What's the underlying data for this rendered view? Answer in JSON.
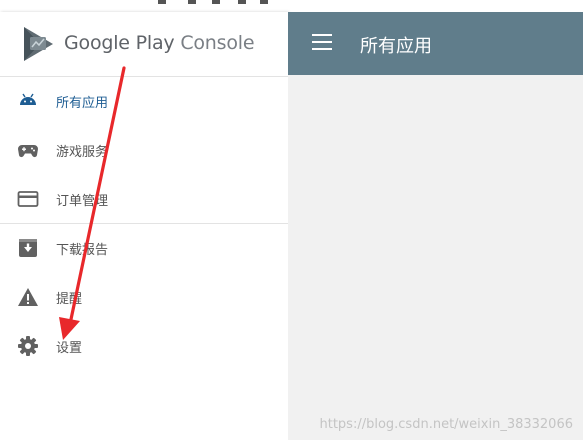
{
  "brand": {
    "name": "Google Play",
    "product": "Console"
  },
  "appbar": {
    "title": "所有应用"
  },
  "nav": {
    "items": [
      {
        "id": "all-apps",
        "label": "所有应用",
        "icon": "android-icon",
        "active": true
      },
      {
        "id": "game-services",
        "label": "游戏服务",
        "icon": "gamepad-icon",
        "active": false
      },
      {
        "id": "orders",
        "label": "订单管理",
        "icon": "credit-card-icon",
        "active": false
      },
      {
        "id": "download-reports",
        "label": "下载报告",
        "icon": "download-box-icon",
        "active": false
      },
      {
        "id": "alerts",
        "label": "提醒",
        "icon": "warning-icon",
        "active": false
      },
      {
        "id": "settings",
        "label": "设置",
        "icon": "gear-icon",
        "active": false
      }
    ]
  },
  "watermark": "https://blog.csdn.net/weixin_38332066",
  "colors": {
    "appbar": "#607d8b",
    "active_link": "#1e5d93",
    "android_green": "#1e5d93",
    "annotation_arrow": "#e8282b"
  }
}
